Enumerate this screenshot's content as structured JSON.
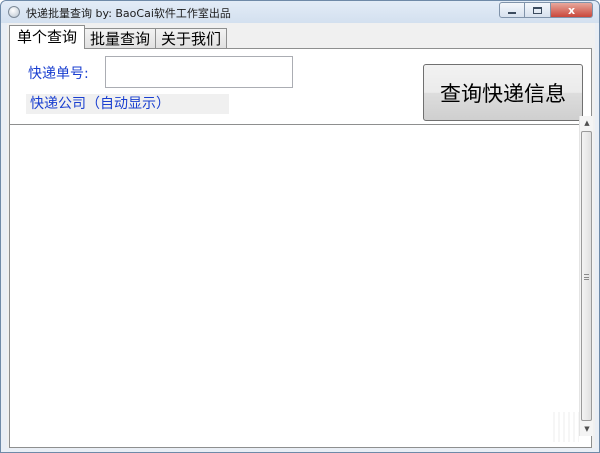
{
  "window": {
    "title": "快递批量查询    by: BaoCai软件工作室出品"
  },
  "caption_buttons": {
    "close_glyph": "x"
  },
  "tabs": [
    {
      "label": "单个查询",
      "active": true
    },
    {
      "label": "批量查询",
      "active": false
    },
    {
      "label": "关于我们",
      "active": false
    }
  ],
  "single_query": {
    "tracking_label": "快递单号:",
    "tracking_value": "",
    "company_display": "快递公司（自动显示）",
    "query_button_label": "查询快递信息"
  },
  "result": {
    "text": ""
  },
  "scrollbar": {
    "up_glyph": "▲",
    "down_glyph": "▼"
  },
  "colors": {
    "label_blue": "#1a3fd0"
  }
}
